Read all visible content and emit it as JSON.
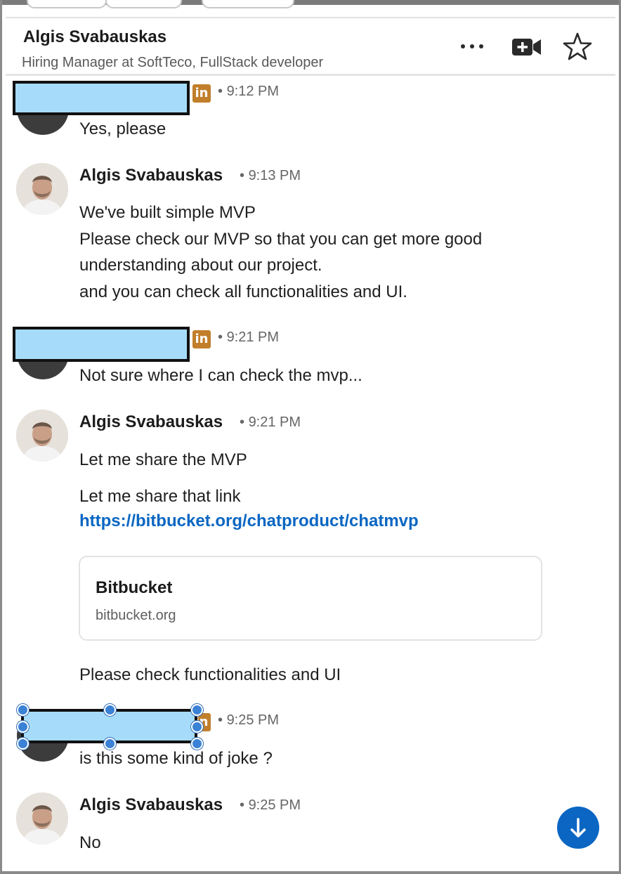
{
  "header": {
    "name": "Algis Svabauskas",
    "subtitle": "Hiring Manager at SoftTeco, FullStack developer",
    "icons": [
      "more-icon",
      "video-call-icon",
      "star-icon"
    ]
  },
  "colors": {
    "link": "#0a66c2",
    "redaction": "#a6dcfa",
    "linkedin_badge": "#c17f2b",
    "scroll_button": "#0a66c2"
  },
  "messages": [
    {
      "time": "9:12 PM",
      "lines": [
        "Yes, please"
      ]
    },
    {
      "sender": "Algis Svabauskas",
      "time": "9:13 PM",
      "lines": [
        "We've built simple MVP",
        "Please check our MVP so that you can get more good",
        "understanding about our project.",
        "and you can check all functionalities and UI."
      ]
    },
    {
      "time": "9:21 PM",
      "lines": [
        "Not sure where I can check the mvp..."
      ]
    },
    {
      "sender": "Algis Svabauskas",
      "time": "9:21 PM",
      "text1": "Let me share the MVP",
      "text2": "Let me share that link",
      "link": "https://bitbucket.org/chatproduct/chatmvp",
      "card": {
        "title": "Bitbucket",
        "domain": "bitbucket.org"
      },
      "text3": "Please check functionalities and UI"
    },
    {
      "time": "9:25 PM",
      "lines": [
        "is this some kind of joke ?"
      ]
    },
    {
      "sender": "Algis Svabauskas",
      "time": "9:25 PM",
      "lines": [
        "No"
      ]
    }
  ],
  "badge_text": "in"
}
